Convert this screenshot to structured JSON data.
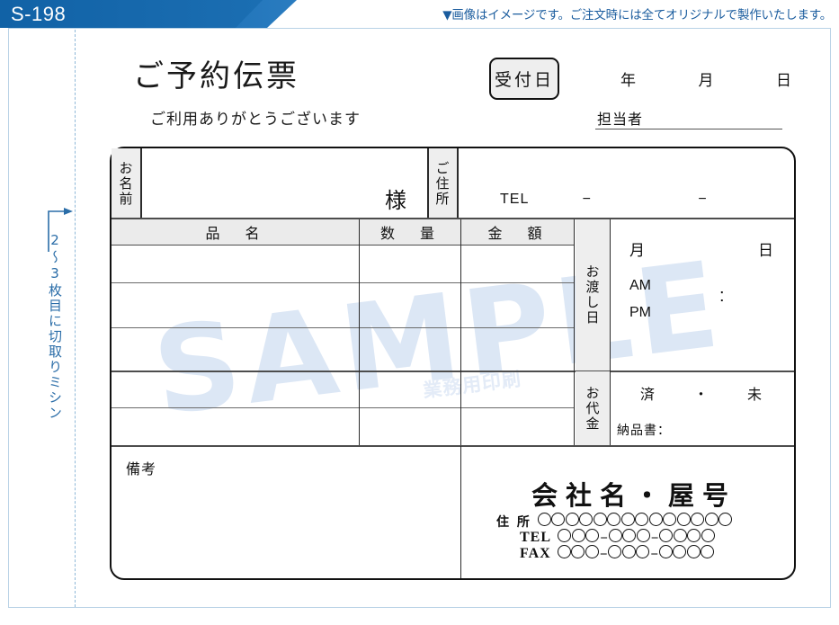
{
  "product_code": "S-198",
  "notice": "▼画像はイメージです。ご注文時には全てオリジナルで製作いたします。",
  "perforation_note": "2〜3枚目に切取りミシン",
  "watermark": {
    "main": "SAMPLE",
    "sub": "業務用印刷"
  },
  "form": {
    "title": "ご予約伝票",
    "subtitle": "ご利用ありがとうございます",
    "receipt_date_label": "受付日",
    "date_units": {
      "year": "年",
      "month": "月",
      "day": "日"
    },
    "staff_label": "担当者",
    "customer": {
      "name_label": "お名前",
      "honorific": "様",
      "address_label": "ご住所",
      "tel_label": "TEL",
      "tel_dash": "−"
    },
    "table": {
      "headers": [
        "品　名",
        "数　量",
        "金　額"
      ],
      "row_count": 5
    },
    "delivery": {
      "label": "お渡し日",
      "month": "月",
      "day": "日",
      "am": "AM",
      "pm": "PM",
      "time_separator": ":"
    },
    "payment": {
      "label": "お代金",
      "paid": "済",
      "separator": "・",
      "unpaid": "未",
      "invoice_label": "納品書："
    },
    "remarks_label": "備考"
  },
  "company": {
    "name": "会社名・屋号",
    "address_label": "住 所",
    "address_circles": 14,
    "tel_label": "TEL",
    "fax_label": "FAX",
    "phone_groups": [
      3,
      3,
      4
    ],
    "hyphen": "−"
  },
  "colors": {
    "tab_blue": "#1565a8",
    "notice_blue": "#1a5c9e",
    "panel_border": "#b9d2e6",
    "perf_blue": "#2a6da8",
    "header_fill": "#ebebeb",
    "watermark": "#dbe6f5"
  }
}
